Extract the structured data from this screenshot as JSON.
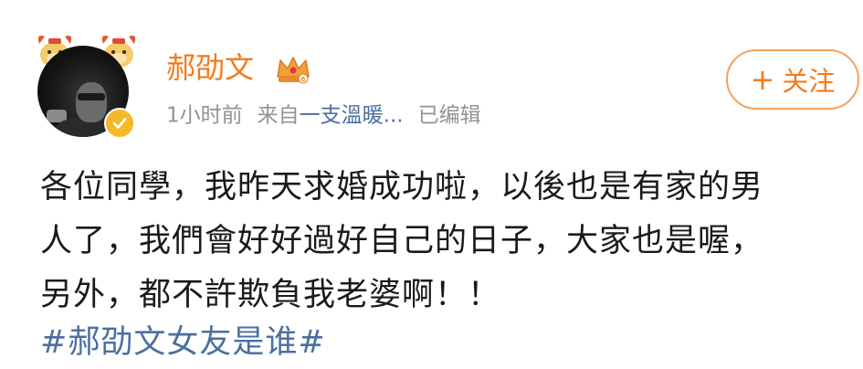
{
  "post": {
    "author": {
      "name": "郝劭文",
      "avatar_icon": "user-avatar",
      "verified_icon": "verified-badge-icon",
      "membership_icon": "crown-icon"
    },
    "meta": {
      "time": "1小时前",
      "source_prefix": "来自",
      "source_name": "一支溫暖...",
      "edited": "已编辑"
    },
    "follow_button": {
      "plus": "+",
      "label": "关注"
    },
    "content": {
      "lines": [
        "各位同學，我昨天求婚成功啦，以後也是有家的男",
        "人了，我們會好好過好自己的日子，大家也是喔，",
        "另外，都不許欺負我老婆啊！！"
      ],
      "hashtag": "#郝劭文女友是谁#"
    }
  },
  "colors": {
    "username": "#f27b1d",
    "meta": "#939393",
    "link": "#4a6fa0",
    "text": "#1a1a1a",
    "follow_border": "#f5a15b",
    "verified": "#f5b82a"
  }
}
